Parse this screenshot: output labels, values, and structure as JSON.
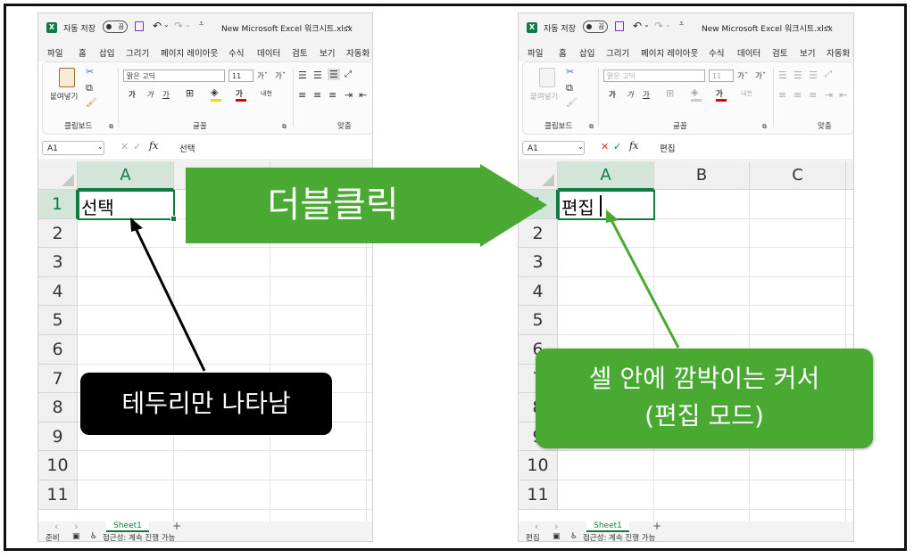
{
  "left": {
    "title": {
      "autosave_label": "자동 저장",
      "autosave_state": "끔",
      "filename": "New Microsoft Excel 워크시트.xlsx",
      "chevron": "⌄"
    },
    "menu": [
      "파일",
      "홈",
      "삽입",
      "그리기",
      "페이지 레이아웃",
      "수식",
      "데이터",
      "검토",
      "보기",
      "자동화"
    ],
    "ribbon": {
      "paste_label": "붙여넣기",
      "clipboard_label": "클립보드",
      "font_name": "맑은 고딕",
      "font_size": "11",
      "grow": "가ˆ",
      "shrink": "가ˇ",
      "bold": "가",
      "italic": "가",
      "underline": "가",
      "font_color_glyph": "가",
      "phonetic": "내천",
      "font_label": "글꼴",
      "align_label": "맞춤"
    },
    "formula": {
      "namebox": "A1",
      "fx": "fx",
      "value": "선택"
    },
    "columns": [
      "A"
    ],
    "rows": [
      "1",
      "2",
      "3",
      "4",
      "5",
      "6",
      "7",
      "8",
      "9",
      "10",
      "11"
    ],
    "cell_a1": "선택",
    "sheet_tab": "Sheet1",
    "status": {
      "mode": "준비",
      "accessibility": "접근성: 계속 진행 가능"
    }
  },
  "right": {
    "title": {
      "autosave_label": "자동 저장",
      "autosave_state": "끔",
      "filename": "New Microsoft Excel 워크시트.xlsx",
      "chevron": "⌄"
    },
    "menu": [
      "파일",
      "홈",
      "삽입",
      "그리기",
      "페이지 레이아웃",
      "수식",
      "데이터",
      "검토",
      "보기",
      "자동화"
    ],
    "ribbon": {
      "paste_label": "붙여넣기",
      "clipboard_label": "클립보드",
      "font_name": "맑은 고딕",
      "font_size": "11",
      "grow": "가ˆ",
      "shrink": "가ˇ",
      "bold": "가",
      "italic": "가",
      "underline": "가",
      "font_color_glyph": "가",
      "phonetic": "내천",
      "font_label": "글꼴",
      "align_label": "맞춤"
    },
    "formula": {
      "namebox": "A1",
      "fx": "fx",
      "value": "편집"
    },
    "columns": [
      "A",
      "B",
      "C"
    ],
    "rows": [
      "1",
      "2",
      "3",
      "4",
      "5",
      "6",
      "7",
      "8",
      "9",
      "10",
      "11"
    ],
    "cell_a1": "편집",
    "sheet_tab": "Sheet1",
    "status": {
      "mode": "편집",
      "accessibility": "접근성: 계속 진행 가능"
    }
  },
  "arrow_label": "더블클릭",
  "callout_left": "테두리만 나타남",
  "callout_right": {
    "line1": "셀 안에 깜박이는 커서",
    "line2": "(편집 모드)"
  },
  "colors": {
    "excel_green": "#107c41",
    "arrow_green": "#4aa933",
    "callout_black": "#000000",
    "header_bg": "#f0f0f0",
    "selected_header_bg": "#d3e4d9"
  }
}
